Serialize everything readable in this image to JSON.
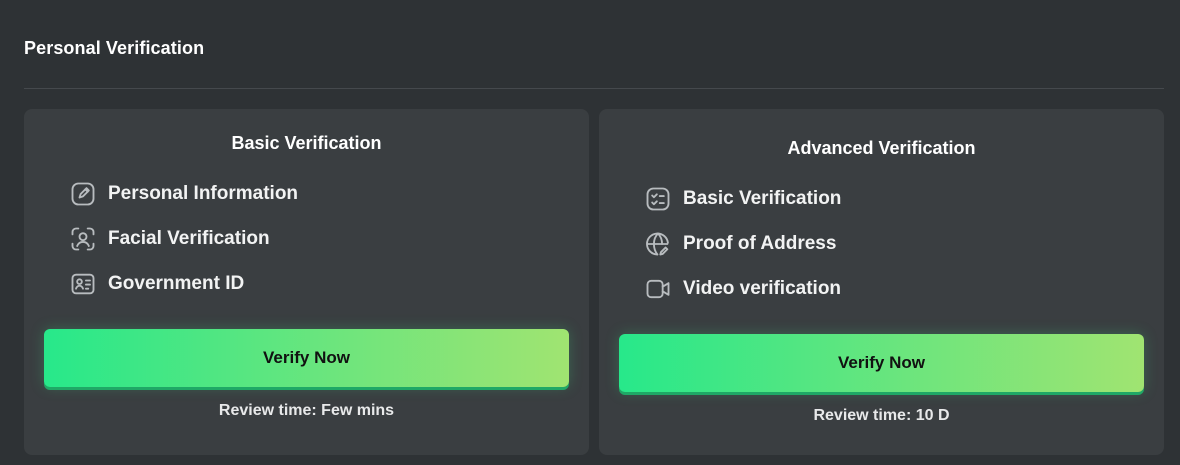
{
  "section": {
    "title": "Personal Verification"
  },
  "cards": [
    {
      "title": "Basic Verification",
      "features": [
        {
          "icon": "edit-icon",
          "label": "Personal Information"
        },
        {
          "icon": "face-scan-icon",
          "label": "Facial Verification"
        },
        {
          "icon": "id-card-icon",
          "label": "Government ID"
        }
      ],
      "button_label": "Verify Now",
      "review_time": "Review time: Few mins"
    },
    {
      "title": "Advanced Verification",
      "features": [
        {
          "icon": "checklist-icon",
          "label": "Basic Verification"
        },
        {
          "icon": "globe-edit-icon",
          "label": "Proof of Address"
        },
        {
          "icon": "video-camera-icon",
          "label": "Video verification"
        }
      ],
      "button_label": "Verify Now",
      "review_time": "Review time: 10 D"
    }
  ],
  "colors": {
    "background": "#2e3235",
    "card": "#3a3e41",
    "button_gradient_start": "#27e88a",
    "button_gradient_end": "#a0e471"
  }
}
